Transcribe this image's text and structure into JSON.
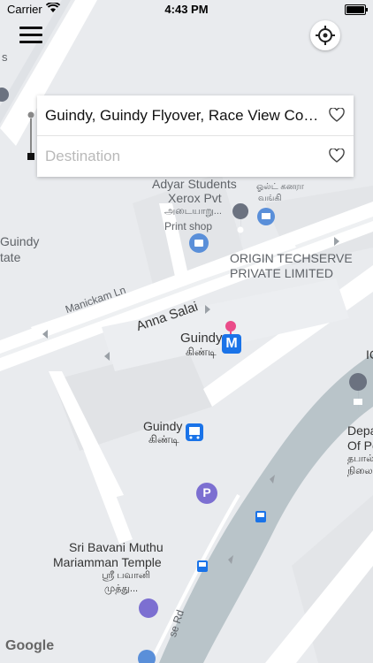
{
  "status": {
    "carrier": "Carrier",
    "time": "4:43 PM"
  },
  "search": {
    "origin": "Guindy, Guindy Flyover, Race View Col...",
    "destination_placeholder": "Destination"
  },
  "map": {
    "labels": {
      "adyar1": "Adyar Students",
      "adyar2": "Xerox Pvt",
      "adyar3": "அடையாறு...",
      "adyar4": "Print shop",
      "bank1": "ஓல்ட் கனரா",
      "bank2": "வங்கி",
      "origin1": "ORIGIN TECHSERVE",
      "origin2": "PRIVATE LIMITED",
      "guindy_left1": "Guindy",
      "guindy_left2": "tate",
      "manickam": "Manickam Ln",
      "anna": "Anna Salai",
      "guindy_metro1": "Guindy",
      "guindy_metro2": "கிண்டி",
      "guindy_rail1": "Guindy",
      "guindy_rail2": "கிண்டி",
      "dep1": "Depa",
      "dep2": "Of Po",
      "dep3": "தபால்",
      "dep4": "நிலை",
      "ic": "IC",
      "temple1": "Sri Bavani Muthu",
      "temple2": "Mariamman Temple",
      "temple3": "ஸ்ரீ பவானி",
      "temple4": "முத்து...",
      "road": "se Rd",
      "metro_letter": "M",
      "parking_letter": "P",
      "google": "Google",
      "top_fragment": "s"
    }
  },
  "colors": {
    "metro": "#1a73e8",
    "pin": "#ea4c89",
    "road_major": "#ffffff",
    "water_green": "#b9c4c9",
    "park": "#9aa0a6"
  }
}
